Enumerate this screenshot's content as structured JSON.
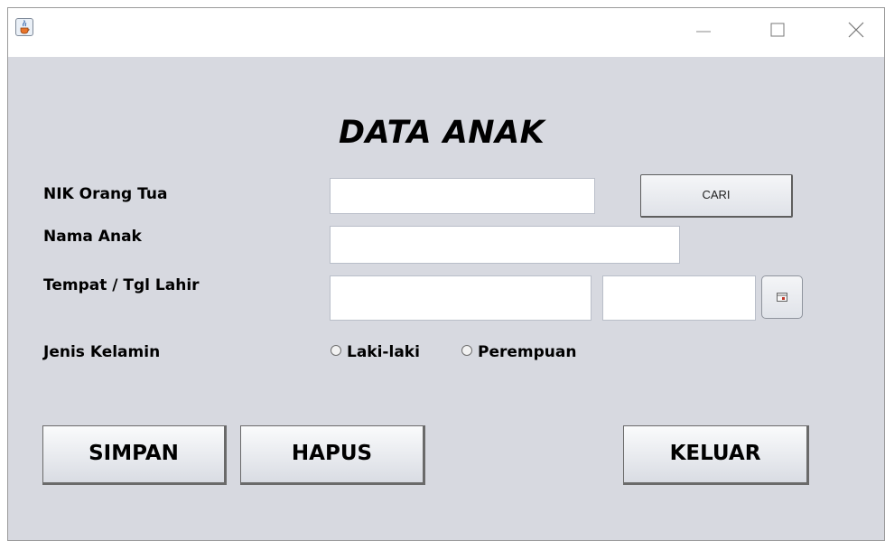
{
  "window": {
    "icon": "java-cup-icon",
    "controls": {
      "minimize": "minimize-icon",
      "maximize": "maximize-icon",
      "close": "close-icon"
    }
  },
  "form": {
    "title": "DATA ANAK",
    "fields": {
      "nik_label": "NIK Orang Tua",
      "nik_value": "",
      "nama_label": "Nama Anak",
      "nama_value": "",
      "ttl_label": "Tempat / Tgl Lahir",
      "tempat_value": "",
      "tanggal_value": "",
      "gender_label": "Jenis Kelamin"
    },
    "cari_label": "CARI",
    "date_picker_icon": "calendar-icon",
    "gender_options": [
      "Laki-laki",
      "Perempuan"
    ],
    "gender_selected": null
  },
  "actions": {
    "simpan": "SIMPAN",
    "hapus": "HAPUS",
    "keluar": "KELUAR"
  },
  "colors": {
    "window_bg": "#d7d9e0",
    "titlebar_bg": "#ffffff"
  }
}
